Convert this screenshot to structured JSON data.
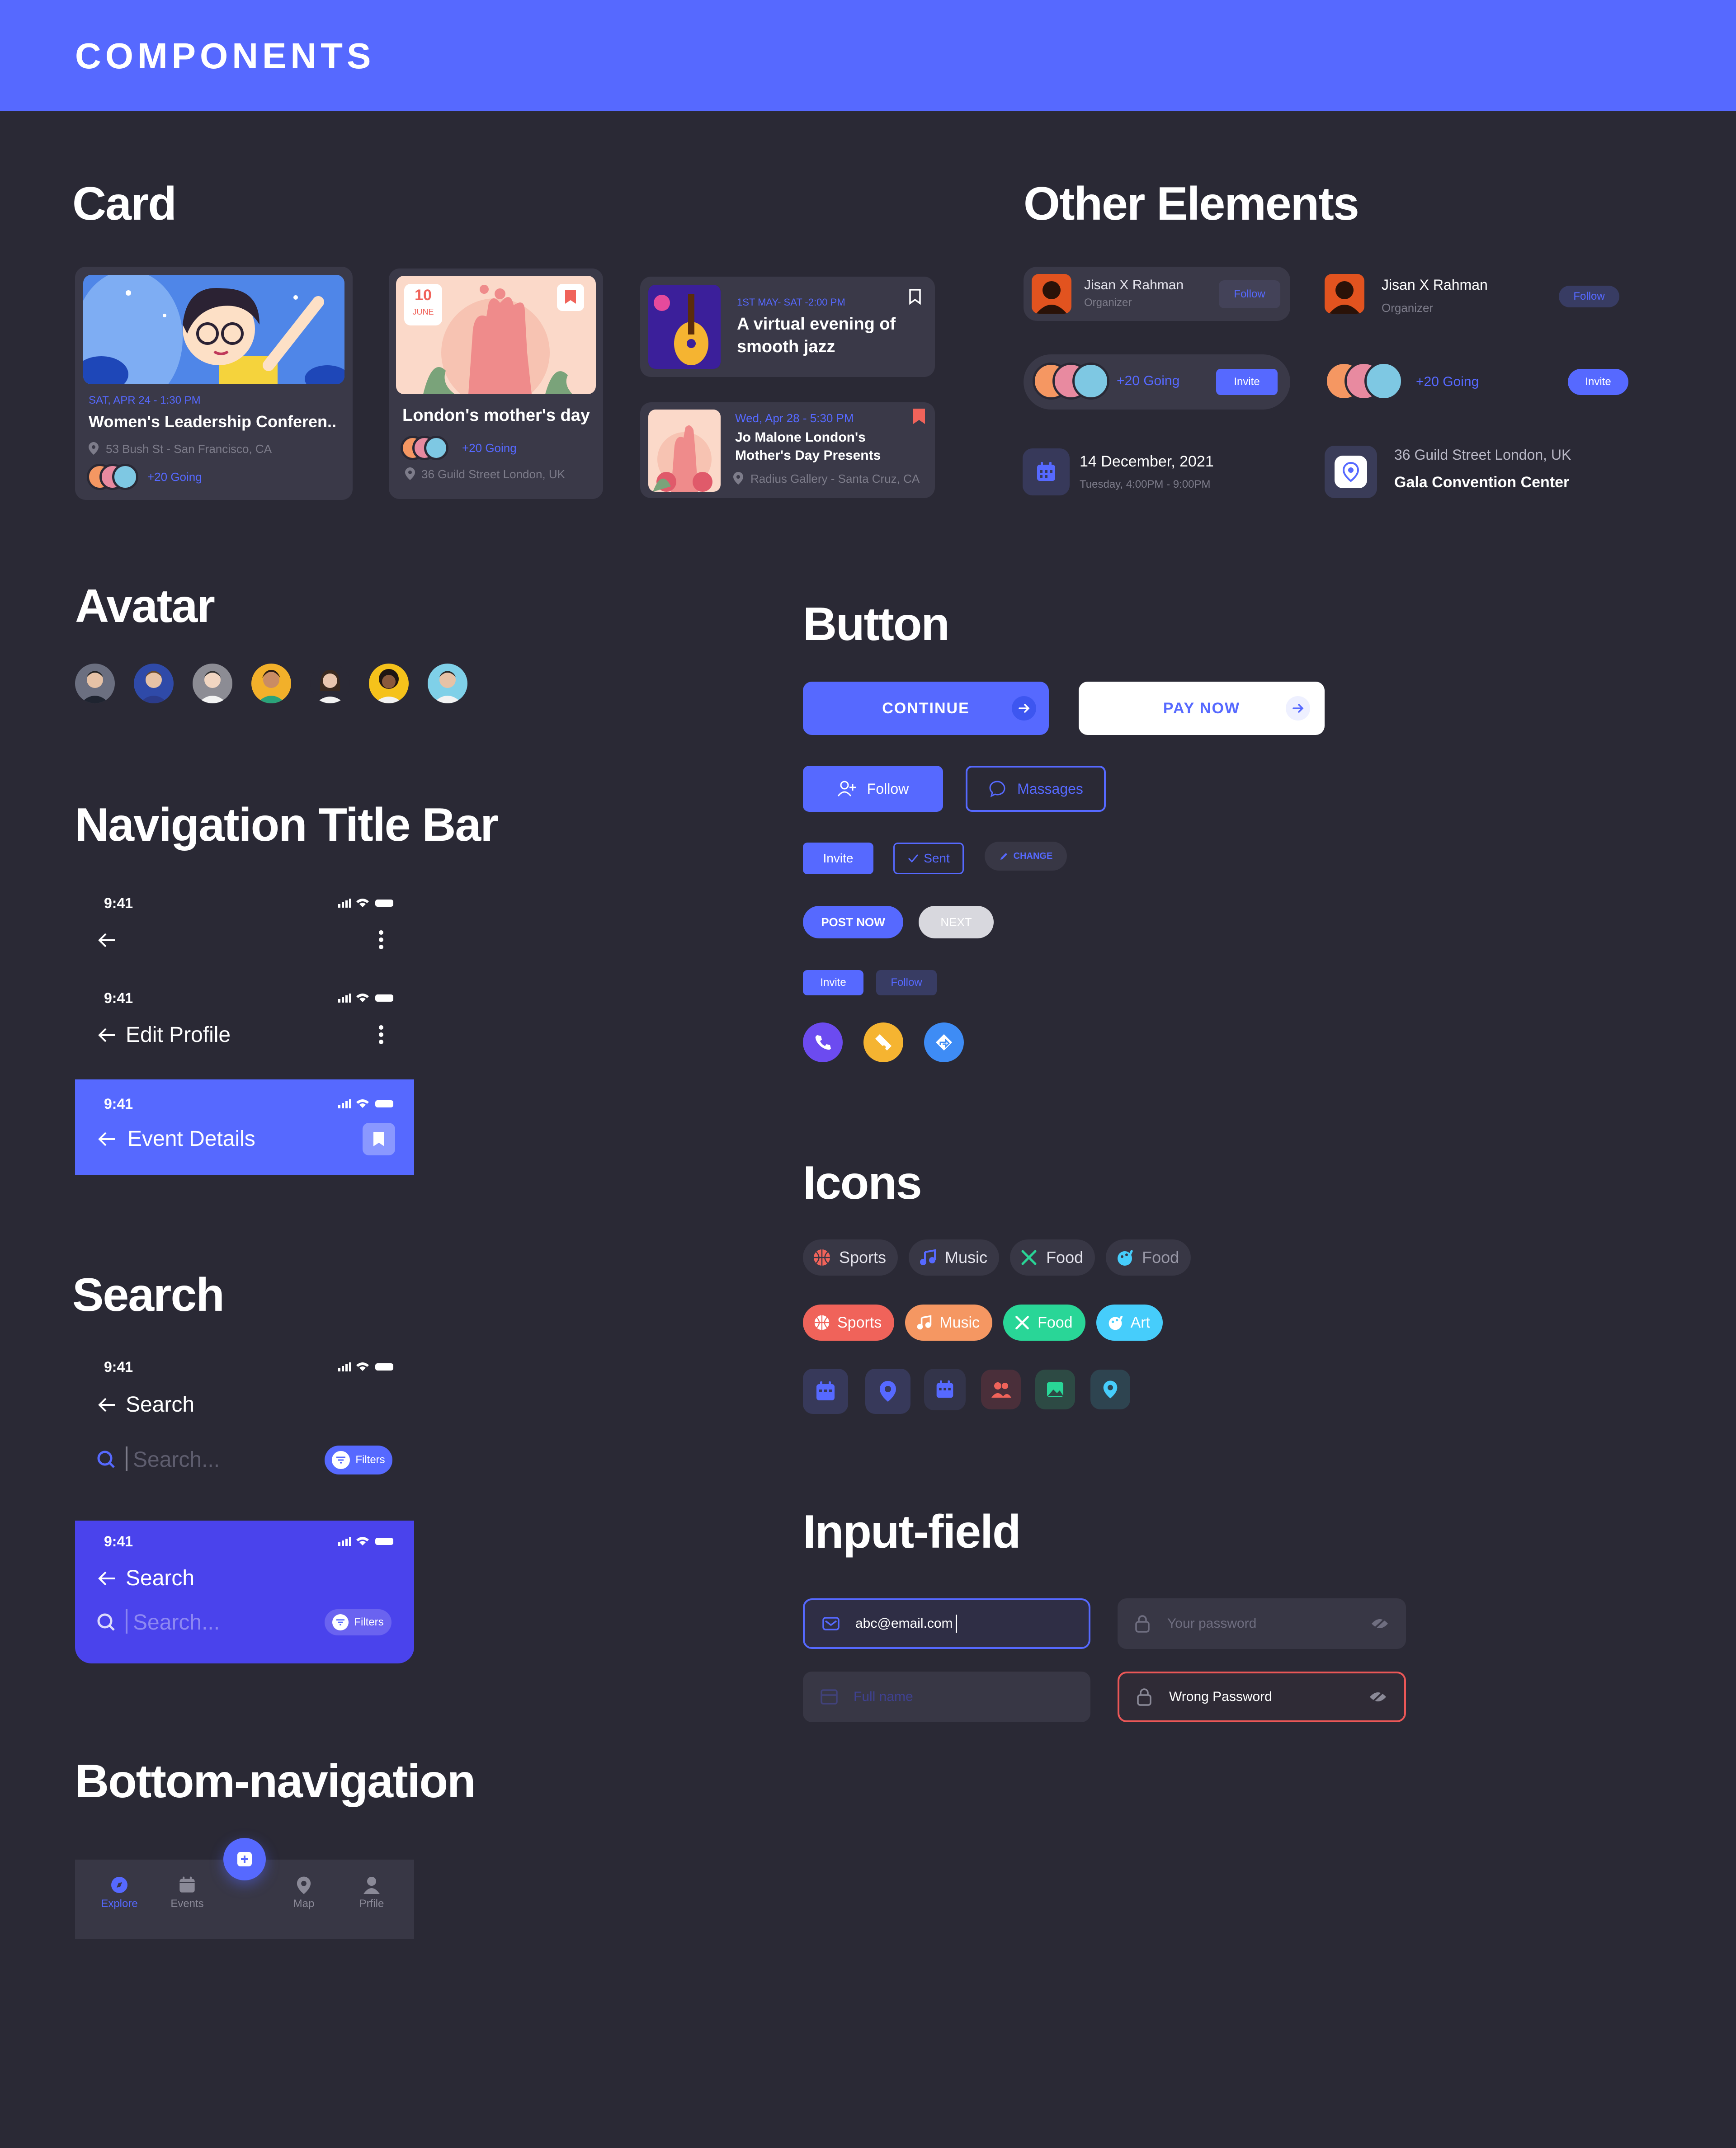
{
  "header": {
    "title": "COMPONENTS"
  },
  "sections": {
    "card": "Card",
    "other": "Other Elements",
    "avatar": "Avatar",
    "button": "Button",
    "nav": "Navigation Title Bar",
    "icons": "Icons",
    "search": "Search",
    "input": "Input-field",
    "bottom": "Bottom-navigation"
  },
  "cards": {
    "c1": {
      "date": "SAT, APR 24 - 1:30 PM",
      "title": "Women's Leadership Conferen..",
      "location": "53 Bush St - San Francisco, CA",
      "going": "+20 Going"
    },
    "c2": {
      "day": "10",
      "month": "JUNE",
      "title": "London's mother's day",
      "going": "+20 Going",
      "location": "36 Guild Street London, UK"
    },
    "c3": {
      "date": "1ST MAY- SAT -2:00 PM",
      "title": "A virtual evening of smooth jazz"
    },
    "c4": {
      "date": "Wed, Apr 28 - 5:30 PM",
      "title": "Jo Malone London's Mother's Day Presents",
      "location": "Radius Gallery - Santa Cruz, CA"
    }
  },
  "other": {
    "org1": {
      "name": "Jisan X Rahman",
      "role": "Organizer",
      "button": "Follow"
    },
    "org2": {
      "name": "Jisan X Rahman",
      "role": "Organizer",
      "button": "Follow"
    },
    "going1": {
      "text": "+20 Going",
      "button": "Invite"
    },
    "going2": {
      "text": "+20 Going",
      "button": "Invite"
    },
    "date": {
      "title": "14 December, 2021",
      "sub": "Tuesday, 4:00PM - 9:00PM"
    },
    "place": {
      "sub": "36 Guild Street London, UK",
      "title": "Gala Convention Center"
    }
  },
  "buttons": {
    "continue": "CONTINUE",
    "paynow": "PAY NOW",
    "follow": "Follow",
    "messages": "Massages",
    "invite": "Invite",
    "sent": "Sent",
    "change": "CHANGE",
    "postnow": "POST NOW",
    "next": "NEXT",
    "invite_sm": "Invite",
    "follow_sm": "Follow"
  },
  "nav": {
    "time": "9:41",
    "edit": "Edit Profile",
    "event": "Event Details"
  },
  "icons": {
    "row1": [
      "Sports",
      "Music",
      "Food",
      "Food"
    ],
    "row2": [
      "Sports",
      "Music",
      "Food",
      "Art"
    ]
  },
  "search": {
    "time": "9:41",
    "title": "Search",
    "placeholder": "Search...",
    "filters": "Filters"
  },
  "inputs": {
    "email": "abc@email.com",
    "password_ph": "Your password",
    "fullname_ph": "Full name",
    "wrong": "Wrong Password"
  },
  "bottomnav": {
    "explore": "Explore",
    "events": "Events",
    "map": "Map",
    "profile": "Prfile"
  },
  "colors": {
    "primary": "#5669ff",
    "bg": "#2a2935",
    "card": "#3a3948",
    "error": "#eb5757",
    "sports": "#f0635a",
    "music": "#f59762",
    "food": "#29d697",
    "art": "#46cdfb"
  }
}
